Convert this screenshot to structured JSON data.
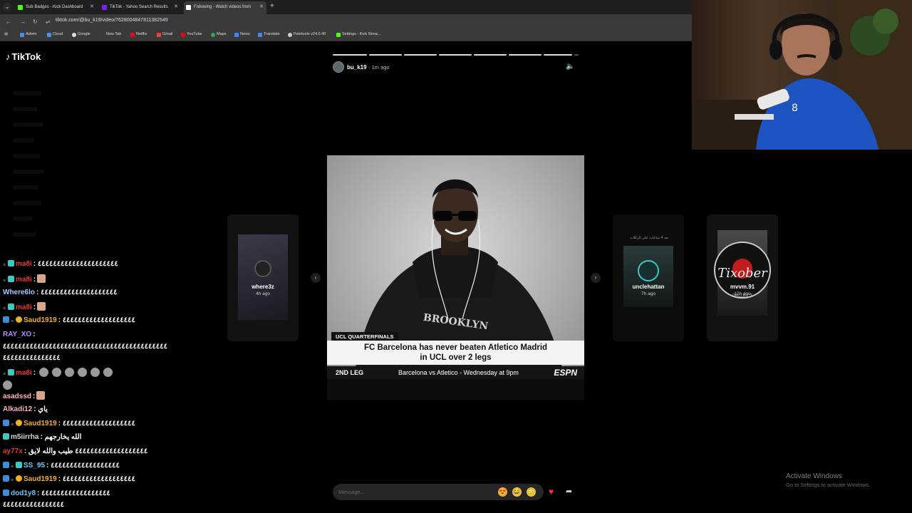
{
  "browser": {
    "tabs": [
      {
        "title": "Sub Badges - Kick Dashboard",
        "fav_color": "#53fc18"
      },
      {
        "title": "TikTok - Yahoo Search Results",
        "fav_color": "#7e1fff"
      },
      {
        "title": "Following - Watch videos from",
        "fav_color": "#ffffff"
      }
    ],
    "url": "tiktok.com/@bu_k19/video/7628004847811382549",
    "bookmarks": [
      {
        "label": "Admin",
        "color": "#4a90e2"
      },
      {
        "label": "Cloud",
        "color": "#4a90e2"
      },
      {
        "label": "Google",
        "color": "#dddddd"
      },
      {
        "label": "New Tab",
        "color": ""
      },
      {
        "label": "Netflix",
        "color": "#e50914"
      },
      {
        "label": "Gmail",
        "color": "#ea4335"
      },
      {
        "label": "YouTube",
        "color": "#ff0000"
      },
      {
        "label": "Maps",
        "color": "#34a853"
      },
      {
        "label": "News",
        "color": "#4285f4"
      },
      {
        "label": "Translate",
        "color": "#4285f4"
      },
      {
        "label": "Paletools v24.0.40",
        "color": "#cccccc"
      },
      {
        "label": "Settings - Kick Strea...",
        "color": "#53fc18"
      }
    ]
  },
  "tiktok": {
    "logo": "TikTok",
    "uploader": {
      "name": "bu_k19",
      "time": "· 1m ago"
    },
    "video": {
      "lower_third_label": "UCL QUARTERFINALS",
      "headline_line1": "FC Barcelona has never beaten Atletico Madrid",
      "headline_line2": "in UCL over 2 legs",
      "leg": "2ND LEG",
      "match": "Barcelona vs Atletico - Wednesday at 9pm",
      "network": "ESPN"
    },
    "side_cards": [
      {
        "user": "where3z",
        "time": "4h ago"
      },
      {
        "user": "unclehattan",
        "time": "7h ago"
      },
      {
        "user": "mvvm.91",
        "time": "12h ago"
      }
    ],
    "side_text": {
      "card2_top": "بعد 4 ساعات على الركلات",
      "card3_brand": "Tixober",
      "card3_sub": "PROJECT"
    },
    "message_placeholder": "Message...",
    "colors": {
      "accent": "#fe2c55"
    }
  },
  "chat": [
    {
      "user": "ma8i",
      "color": "#e03b3b",
      "badges": [
        "arrow",
        "grid"
      ],
      "text": ": ٤٤٤٤٤٤٤٤٤٤٤٤٤٤٤٤٤٤٤٤٤",
      "emotes": 0
    },
    {
      "user": "ma8i",
      "color": "#e03b3b",
      "badges": [
        "arrow",
        "grid"
      ],
      "text": ":",
      "emotes": 1
    },
    {
      "user": "Where6lo",
      "color": "#a8c8ff",
      "badges": [],
      "text": ": ٤٤٤٤٤٤٤٤٤٤٤٤٤٤٤٤٤٤٤٤",
      "emotes": 0
    },
    {
      "user": "ma8i",
      "color": "#e03b3b",
      "badges": [
        "arrow",
        "grid"
      ],
      "text": ":",
      "emotes": 1
    },
    {
      "user": "Saud1919",
      "color": "#f2b21e",
      "badges": [
        "blue",
        "arrow",
        "gold"
      ],
      "text": ": ٤٤٤٤٤٤٤٤٤٤٤٤٤٤٤٤٤٤٤",
      "emotes": 0
    },
    {
      "user": "RAY_XO",
      "color": "#b48cff",
      "badges": [],
      "text": ":",
      "emotes": 0
    },
    {
      "user": "ma8i",
      "color": "#e03b3b",
      "badges": [
        "arrow",
        "grid"
      ],
      "text": ":",
      "emotes": 6
    },
    {
      "user": "asadssd",
      "color": "#ffb0c0",
      "badges": [],
      "text": ":",
      "emotes": 1
    },
    {
      "user": "Alkadi12",
      "color": "#ffb0c0",
      "badges": [],
      "text": ": ياي",
      "emotes": 0
    },
    {
      "user": "Saud1919",
      "color": "#f2b21e",
      "badges": [
        "blue",
        "arrow",
        "gold"
      ],
      "text": ": ٤٤٤٤٤٤٤٤٤٤٤٤٤٤٤٤٤٤٤",
      "emotes": 0
    },
    {
      "user": "m5iirrha",
      "color": "#d8d8d8",
      "badges": [
        "grid"
      ],
      "text": ": الله يخارجهم",
      "emotes": 0
    },
    {
      "user": "ay77x",
      "color": "#e03b3b",
      "badges": [],
      "text": ": ٤٤٤٤٤٤٤٤٤٤٤٤٤٤٤٤٤٤٤ طيب والله لايق",
      "emotes": 0
    },
    {
      "user": "SS_95",
      "color": "#6ec6ff",
      "badges": [
        "blue",
        "arrow",
        "grid"
      ],
      "text": ": ٤٤٤٤٤٤٤٤٤٤٤٤٤٤٤٤٤٤",
      "emotes": 0
    },
    {
      "user": "Saud1919",
      "color": "#f2b21e",
      "badges": [
        "blue",
        "arrow",
        "gold"
      ],
      "text": ": ٤٤٤٤٤٤٤٤٤٤٤٤٤٤٤٤٤٤٤",
      "emotes": 0
    },
    {
      "user": "dod1y8",
      "color": "#6ec6ff",
      "badges": [
        "blue"
      ],
      "text": ": ٤٤٤٤٤٤٤٤٤٤٤٤٤٤٤٤٤٤",
      "emotes": 0
    }
  ],
  "chat_continuations": [
    "٤٤٤٤٤٤٤٤٤٤٤٤٤٤٤٤٤٤٤٤٤٤٤٤٤٤٤٤٤٤٤٤٤٤٤٤٤٤٤٤٤٤٤",
    "٤٤٤٤٤٤٤٤٤٤٤٤٤٤٤",
    "٤٤٤٤٤٤٤٤٤٤٤٤٤٤٤٤"
  ],
  "watermark": {
    "title": "Activate Windows",
    "subtitle": "Go to Settings to activate Windows."
  }
}
